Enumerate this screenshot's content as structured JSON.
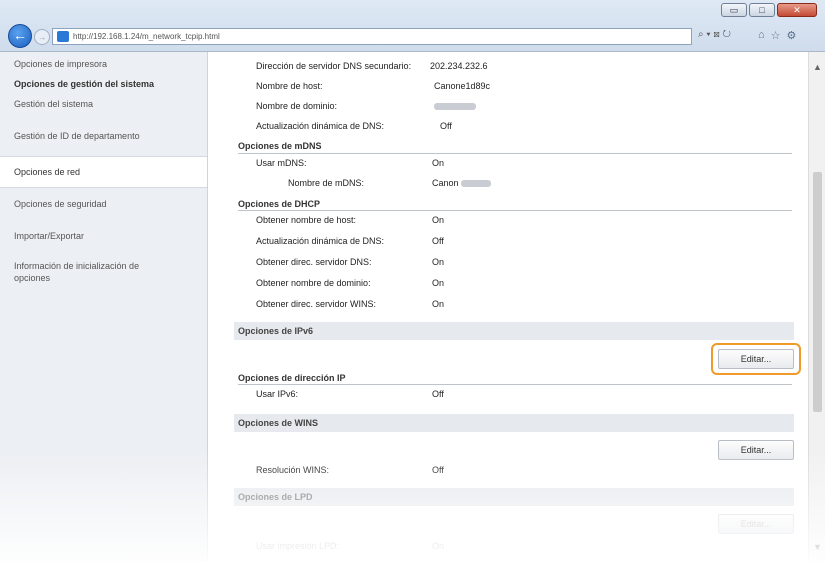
{
  "browser": {
    "url": "http://192.168.1.24/m_network_tcpip.html",
    "url_host": "192.168.1.24",
    "window_controls": {
      "minimize": "▭",
      "maximize": "□",
      "close": "✕"
    },
    "address_controls": "⌕ ▾ ⊠ ↻",
    "nav_icons": {
      "home": "⌂",
      "favorites": "☆",
      "tools": "⚙"
    }
  },
  "sidebar": {
    "items": [
      {
        "label": "Opciones de impresora"
      },
      {
        "label": "Opciones de gestión del sistema"
      },
      {
        "label": "Gestión del sistema"
      },
      {
        "label": "Gestión de ID de departamento"
      },
      {
        "label": "Opciones de red"
      },
      {
        "label": "Opciones de seguridad"
      },
      {
        "label": "Importar/Exportar"
      },
      {
        "label": "Información de inicialización de opciones"
      }
    ]
  },
  "dns": {
    "secondary_label": "Dirección de servidor DNS secundario:",
    "secondary_value": "202.234.232.6",
    "host_label": "Nombre de host:",
    "host_value": "Canone1d89c",
    "domain_label": "Nombre de dominio:",
    "dynamic_label": "Actualización dinámica de DNS:",
    "dynamic_value": "Off"
  },
  "mdns": {
    "header": "Opciones de mDNS",
    "use_label": "Usar mDNS:",
    "use_value": "On",
    "name_label": "Nombre de mDNS:",
    "name_value": "Canon"
  },
  "dhcp": {
    "header": "Opciones de DHCP",
    "rows": [
      {
        "label": "Obtener nombre de host:",
        "value": "On"
      },
      {
        "label": "Actualización dinámica de DNS:",
        "value": "Off"
      },
      {
        "label": "Obtener direc. servidor DNS:",
        "value": "On"
      },
      {
        "label": "Obtener nombre de dominio:",
        "value": "On"
      },
      {
        "label": "Obtener direc. servidor WINS:",
        "value": "On"
      }
    ]
  },
  "ipv6": {
    "section": "Opciones de IPv6",
    "edit_label": "Editar...",
    "address_header": "Opciones de dirección IP",
    "use_label": "Usar IPv6:",
    "use_value": "Off"
  },
  "wins": {
    "section": "Opciones de WINS",
    "edit_label": "Editar...",
    "resolution_label": "Resolución WINS:",
    "resolution_value": "Off"
  },
  "lpd": {
    "section": "Opciones de LPD",
    "edit_label": "Editar...",
    "use_label": "Usar impresión LPD:",
    "use_value": "On"
  },
  "colors": {
    "highlight": "#f09a2a",
    "accent": "#1a5fbf"
  }
}
